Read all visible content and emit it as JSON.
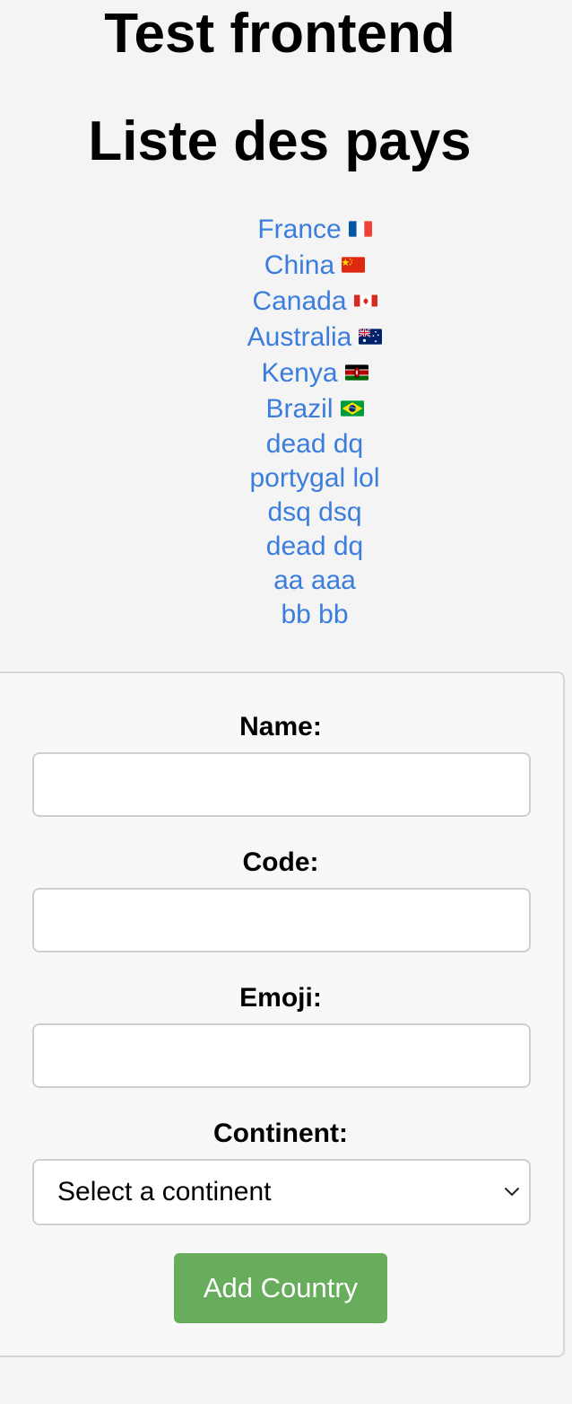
{
  "header": {
    "title": "Test frontend",
    "list_title": "Liste des pays"
  },
  "countries": [
    {
      "label": "France",
      "flag": "flag-france-icon"
    },
    {
      "label": "China",
      "flag": "flag-china-icon"
    },
    {
      "label": "Canada",
      "flag": "flag-canada-icon"
    },
    {
      "label": "Australia",
      "flag": "flag-australia-icon"
    },
    {
      "label": "Kenya",
      "flag": "flag-kenya-icon"
    },
    {
      "label": "Brazil",
      "flag": "flag-brazil-icon"
    },
    {
      "label": "dead dq"
    },
    {
      "label": "portygal lol"
    },
    {
      "label": "dsq dsq"
    },
    {
      "label": "dead dq"
    },
    {
      "label": "aa aaa"
    },
    {
      "label": "bb bb"
    }
  ],
  "form": {
    "name_label": "Name:",
    "name_value": "",
    "code_label": "Code:",
    "code_value": "",
    "emoji_label": "Emoji:",
    "emoji_value": "",
    "continent_label": "Continent:",
    "continent_selected": "Select a continent",
    "submit_label": "Add Country"
  },
  "colors": {
    "link": "#3b7ddd",
    "button": "#67ad5b",
    "background": "#f4f4f4"
  }
}
